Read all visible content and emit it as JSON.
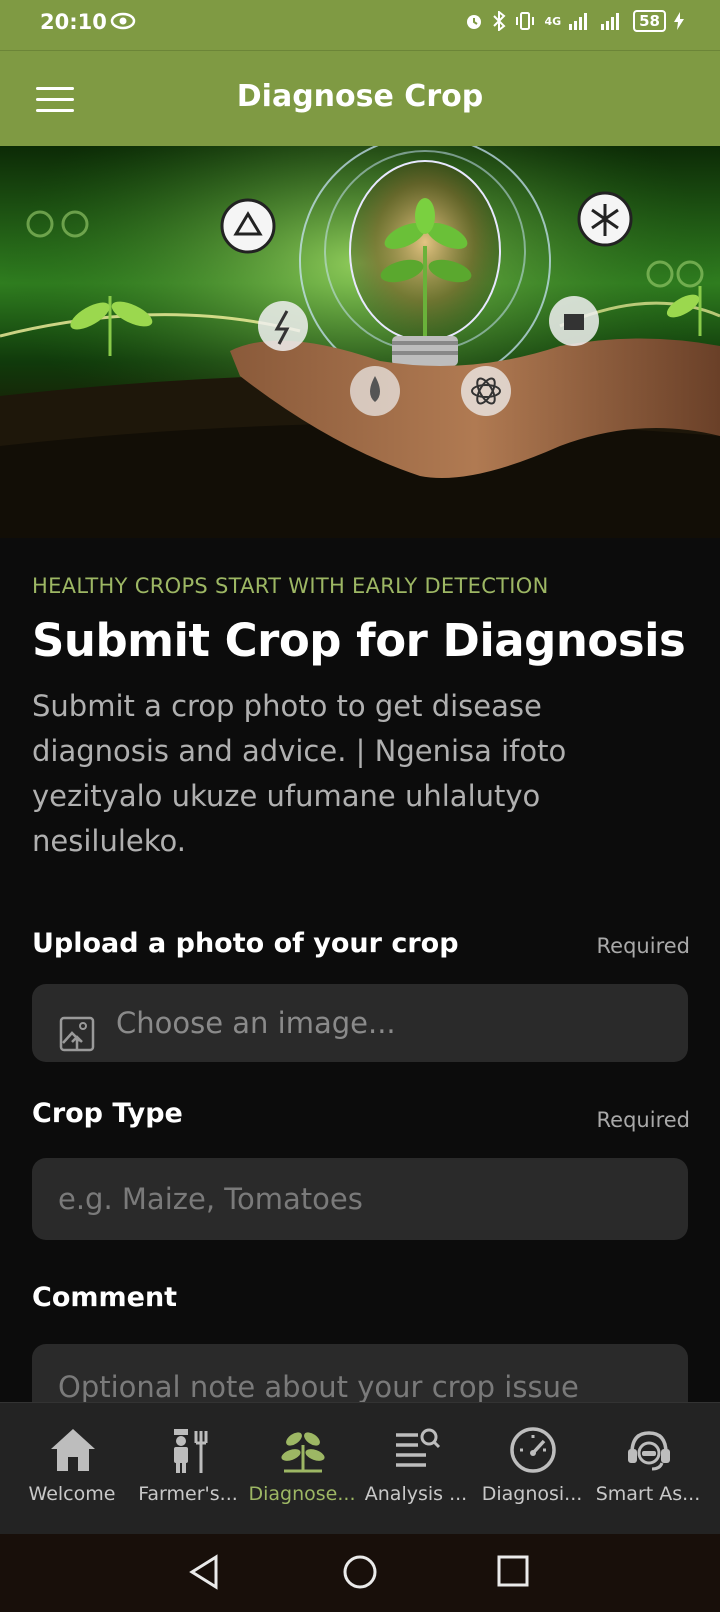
{
  "status_bar": {
    "time": "20:10",
    "network": "4G",
    "battery": "58"
  },
  "app_bar": {
    "title": "Diagnose Crop",
    "menu_icon": "hamburger-menu-icon"
  },
  "hero": {
    "icons": [
      "recycle-icon",
      "windmill-icon",
      "lightning-icon",
      "factory-icon",
      "water-drop-icon",
      "atom-icon",
      "lightbulb-plant-icon"
    ]
  },
  "main": {
    "eyebrow": "HEALTHY CROPS START WITH EARLY DETECTION",
    "title": "Submit Crop for Diagnosis",
    "description": "Submit a crop photo to get disease diagnosis and advice. | Ngenisa ifoto yezityalo ukuze ufumane uhlalutyo nesiluleko."
  },
  "form": {
    "photo": {
      "label": "Upload a photo of your crop",
      "required": "Required",
      "placeholder": "Choose an image..."
    },
    "crop_type": {
      "label": "Crop Type",
      "required": "Required",
      "placeholder": "e.g. Maize, Tomatoes"
    },
    "comment": {
      "label": "Comment",
      "placeholder": "Optional note about your crop issue"
    }
  },
  "bottom_nav": {
    "items": [
      {
        "label": "Welcome",
        "icon": "home-icon"
      },
      {
        "label": "Farmer's...",
        "icon": "farmer-icon"
      },
      {
        "label": "Diagnose...",
        "icon": "plant-icon",
        "active": true
      },
      {
        "label": "Analysis ...",
        "icon": "list-search-icon"
      },
      {
        "label": "Diagnosi...",
        "icon": "gauge-icon"
      },
      {
        "label": "Smart As...",
        "icon": "headset-icon"
      }
    ]
  },
  "colors": {
    "accent": "#7f9a43",
    "accent_text": "#9db764",
    "background": "#0c0c0c",
    "field": "#2a2a2a"
  }
}
